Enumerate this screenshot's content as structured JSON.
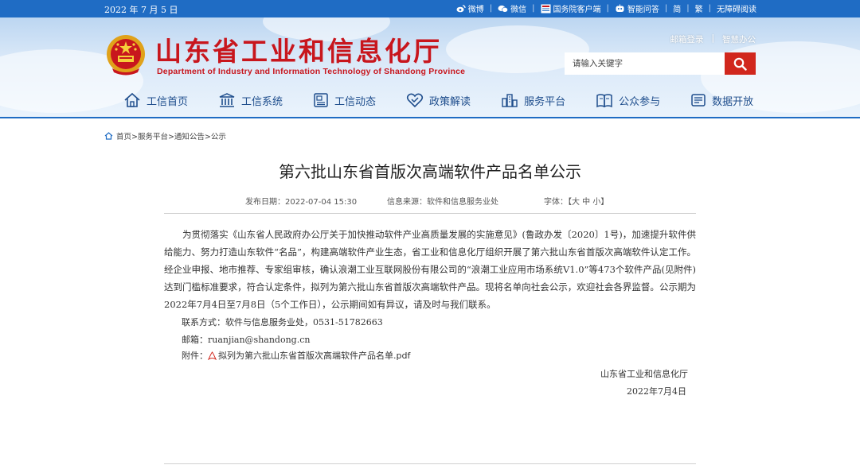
{
  "topbar": {
    "date": "2022 年 7 月 5 日",
    "weibo": "微博",
    "wechat": "微信",
    "gov_client": "国务院客户端",
    "smart_qa": "智能问答",
    "simplified": "简",
    "traditional": "繁",
    "accessible": "无障碍阅读"
  },
  "header": {
    "title_cn": "山东省工业和信息化厅",
    "title_en": "Department of Industry and Information Technology of Shandong Province",
    "mailbox_login": "邮箱登录",
    "smart_office": "智慧办公",
    "search_placeholder": "请输入关键字"
  },
  "nav": [
    {
      "label": "工信首页",
      "icon": "home-icon"
    },
    {
      "label": "工信系统",
      "icon": "building-icon"
    },
    {
      "label": "工信动态",
      "icon": "news-icon"
    },
    {
      "label": "政策解读",
      "icon": "heart-shield-icon"
    },
    {
      "label": "服务平台",
      "icon": "city-icon"
    },
    {
      "label": "公众参与",
      "icon": "book-icon"
    },
    {
      "label": "数据开放",
      "icon": "data-icon"
    }
  ],
  "breadcrumb": "首页>服务平台>通知公告>公示",
  "article": {
    "title": "第六批山东省首版次高端软件产品名单公示",
    "publish_date": "发布日期：2022-07-04 15:30",
    "source": "信息来源：软件和信息服务业处",
    "font_size": "字体：【大 中 小】",
    "paragraph": "为贯彻落实《山东省人民政府办公厅关于加快推动软件产业高质量发展的实施意见》(鲁政办发〔2020〕1号)，加速提升软件供给能力、努力打造山东软件“名品”，构建高端软件产业生态，省工业和信息化厅组织开展了第六批山东省首版次高端软件认定工作。经企业申报、地市推荐、专家组审核，确认浪潮工业互联网股份有限公司的“浪潮工业应用市场系统V1.0”等473个软件产品(见附件)达到门槛标准要求，符合认定条件，拟列为第六批山东省首版次高端软件产品。现将名单向社会公示，欢迎社会各界监督。公示期为2022年7月4日至7月8日（5个工作日），公示期间如有异议，请及时与我们联系。",
    "contact": "联系方式：软件与信息服务业处，0531-51782663",
    "email": "邮箱：ruanjian@shandong.cn",
    "attachment_label": "附件：",
    "attachment_link": "拟列为第六批山东省首版次高端软件产品名单.pdf",
    "signature": "山东省工业和信息化厅",
    "sign_date": "2022年7月4日"
  },
  "colors": {
    "topbar_blue": "#1f6cc4",
    "title_red": "#c8161d",
    "nav_blue": "#1e4d8c",
    "search_red": "#d1271d"
  }
}
